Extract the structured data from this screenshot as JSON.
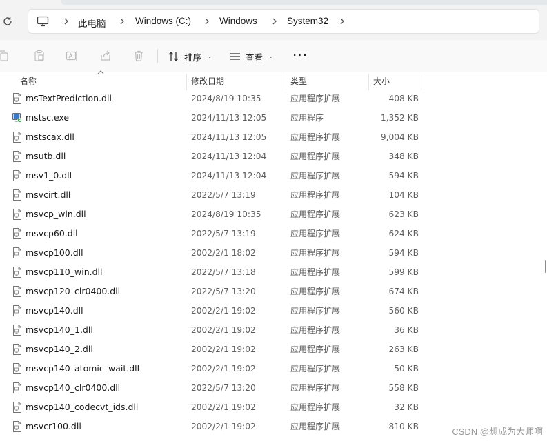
{
  "address_bar": {
    "breadcrumbs": [
      {
        "label": "此电脑"
      },
      {
        "label": "Windows (C:)"
      },
      {
        "label": "Windows"
      },
      {
        "label": "System32"
      }
    ]
  },
  "toolbar": {
    "sort_label": "排序",
    "view_label": "查看",
    "more_label": "···"
  },
  "columns": {
    "name": "名称",
    "date": "修改日期",
    "type": "类型",
    "size": "大小"
  },
  "files": [
    {
      "name": "msTextPrediction.dll",
      "date": "2024/8/19 10:35",
      "type": "应用程序扩展",
      "size": "408 KB",
      "icon": "dll-file-icon"
    },
    {
      "name": "mstsc.exe",
      "date": "2024/11/13 12:05",
      "type": "应用程序",
      "size": "1,352 KB",
      "icon": "remote-desktop-exe-icon"
    },
    {
      "name": "mstscax.dll",
      "date": "2024/11/13 12:05",
      "type": "应用程序扩展",
      "size": "9,004 KB",
      "icon": "dll-file-icon"
    },
    {
      "name": "msutb.dll",
      "date": "2024/11/13 12:04",
      "type": "应用程序扩展",
      "size": "348 KB",
      "icon": "dll-file-icon"
    },
    {
      "name": "msv1_0.dll",
      "date": "2024/11/13 12:04",
      "type": "应用程序扩展",
      "size": "594 KB",
      "icon": "dll-file-icon"
    },
    {
      "name": "msvcirt.dll",
      "date": "2022/5/7 13:19",
      "type": "应用程序扩展",
      "size": "104 KB",
      "icon": "dll-file-icon"
    },
    {
      "name": "msvcp_win.dll",
      "date": "2024/8/19 10:35",
      "type": "应用程序扩展",
      "size": "623 KB",
      "icon": "dll-file-icon"
    },
    {
      "name": "msvcp60.dll",
      "date": "2022/5/7 13:19",
      "type": "应用程序扩展",
      "size": "624 KB",
      "icon": "dll-file-icon"
    },
    {
      "name": "msvcp100.dll",
      "date": "2002/2/1 18:02",
      "type": "应用程序扩展",
      "size": "594 KB",
      "icon": "dll-file-icon"
    },
    {
      "name": "msvcp110_win.dll",
      "date": "2022/5/7 13:18",
      "type": "应用程序扩展",
      "size": "599 KB",
      "icon": "dll-file-icon"
    },
    {
      "name": "msvcp120_clr0400.dll",
      "date": "2022/5/7 13:20",
      "type": "应用程序扩展",
      "size": "674 KB",
      "icon": "dll-file-icon"
    },
    {
      "name": "msvcp140.dll",
      "date": "2002/2/1 19:02",
      "type": "应用程序扩展",
      "size": "560 KB",
      "icon": "dll-file-icon"
    },
    {
      "name": "msvcp140_1.dll",
      "date": "2002/2/1 19:02",
      "type": "应用程序扩展",
      "size": "36 KB",
      "icon": "dll-file-icon"
    },
    {
      "name": "msvcp140_2.dll",
      "date": "2002/2/1 19:02",
      "type": "应用程序扩展",
      "size": "263 KB",
      "icon": "dll-file-icon"
    },
    {
      "name": "msvcp140_atomic_wait.dll",
      "date": "2002/2/1 19:02",
      "type": "应用程序扩展",
      "size": "50 KB",
      "icon": "dll-file-icon"
    },
    {
      "name": "msvcp140_clr0400.dll",
      "date": "2022/5/7 13:20",
      "type": "应用程序扩展",
      "size": "558 KB",
      "icon": "dll-file-icon"
    },
    {
      "name": "msvcp140_codecvt_ids.dll",
      "date": "2002/2/1 19:02",
      "type": "应用程序扩展",
      "size": "32 KB",
      "icon": "dll-file-icon"
    },
    {
      "name": "msvcr100.dll",
      "date": "2002/2/1 19:02",
      "type": "应用程序扩展",
      "size": "810 KB",
      "icon": "dll-file-icon"
    }
  ],
  "watermark": "CSDN @想成为大师啊"
}
